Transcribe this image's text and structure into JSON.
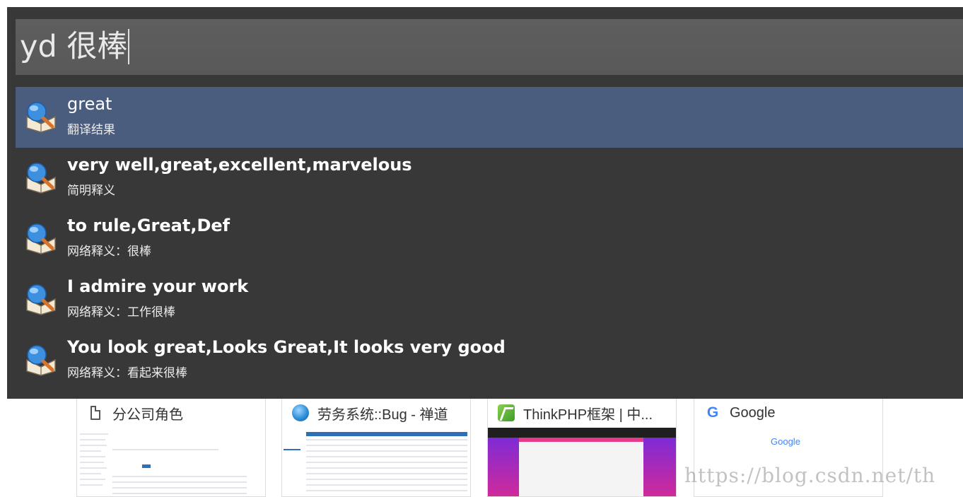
{
  "launcher": {
    "query_text": "yd 很棒",
    "results": [
      {
        "title": "great",
        "subtitle": "翻译结果",
        "icon": "dictionary-icon",
        "selected": true
      },
      {
        "title": "very well,great,excellent,marvelous",
        "subtitle": "简明释义",
        "icon": "dictionary-icon",
        "selected": false
      },
      {
        "title": "to rule,Great,Def",
        "subtitle": "网络释义：很棒",
        "icon": "dictionary-icon",
        "selected": false
      },
      {
        "title": "I admire your work",
        "subtitle": "网络释义：工作很棒",
        "icon": "dictionary-icon",
        "selected": false
      },
      {
        "title": "You look great,Looks Great,It looks very good",
        "subtitle": "网络释义：看起来很棒",
        "icon": "dictionary-icon",
        "selected": false
      }
    ]
  },
  "browser": {
    "tiles": [
      {
        "title": "分公司角色",
        "icon": "document-icon"
      },
      {
        "title": "劳务系统::Bug - 禅道",
        "icon": "globe-icon"
      },
      {
        "title": "ThinkPHP框架 | 中...",
        "icon": "thinkphp-icon"
      },
      {
        "title": "Google",
        "icon": "google-icon",
        "thumb_text": "Google"
      }
    ],
    "watermark": "https://blog.csdn.net/th"
  },
  "colors": {
    "launcher_bg": "#383838",
    "query_bg": "#5d5d5d",
    "selected_bg": "#4a5d7e",
    "text": "#ffffff"
  }
}
